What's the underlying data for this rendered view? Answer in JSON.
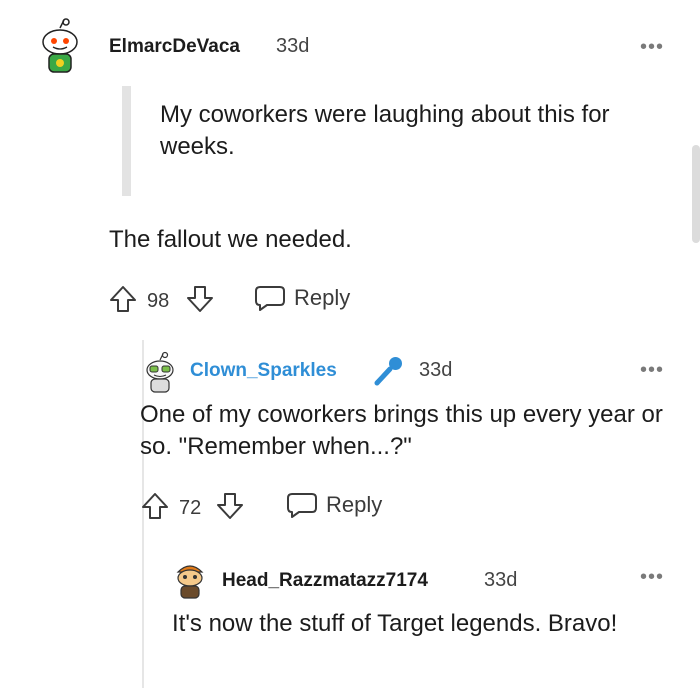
{
  "comments": [
    {
      "author": "ElmarcDeVaca",
      "age": "33d",
      "more": "•••",
      "quote": "My coworkers were laughing about this for weeks.",
      "text": "The fallout we needed.",
      "votes": "98",
      "reply_label": "Reply"
    },
    {
      "author": "Clown_Sparkles",
      "age": "33d",
      "more": "•••",
      "text": "One of my coworkers brings this up every year or so. \"Remember when...?\"",
      "votes": "72",
      "reply_label": "Reply",
      "flair_icon": "microphone-icon",
      "author_color": "#2f8ed6"
    },
    {
      "author": "Head_Razzmatazz7174",
      "age": "33d",
      "more": "•••",
      "text": "It's now the stuff of Target legends. Bravo!"
    }
  ],
  "colors": {
    "background": "#ffffff",
    "text": "#1c1c1c",
    "muted": "#444444",
    "link_blue": "#2f8ed6",
    "quote_bar": "#e3e3e3"
  }
}
